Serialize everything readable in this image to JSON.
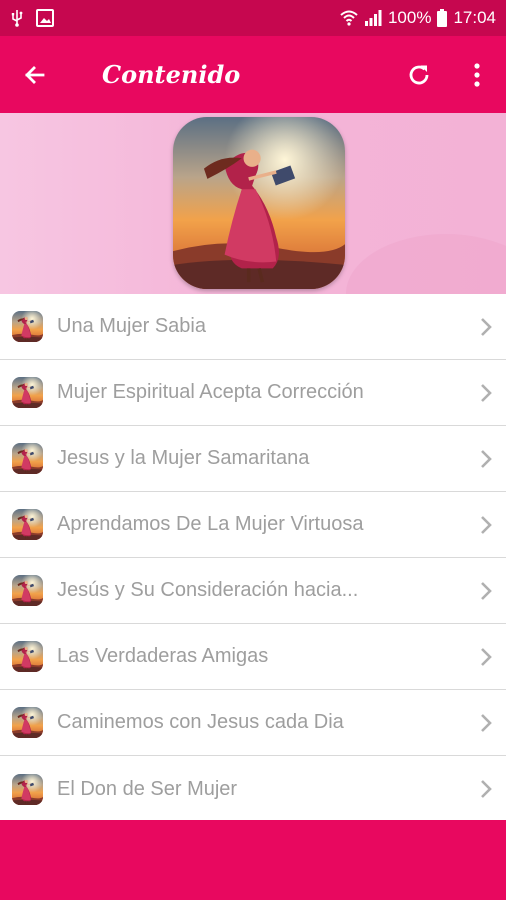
{
  "status_bar": {
    "battery": "100%",
    "time": "17:04",
    "icons": [
      "usb-icon",
      "image-icon",
      "wifi-icon",
      "signal-icon",
      "battery-icon"
    ]
  },
  "app_bar": {
    "title": "Contenido",
    "icons": [
      "arrow-back-icon",
      "refresh-icon",
      "more-vert-icon"
    ]
  },
  "list": {
    "items": [
      {
        "label": "Una Mujer Sabia"
      },
      {
        "label": "Mujer Espiritual Acepta Corrección"
      },
      {
        "label": "Jesus y la Mujer Samaritana"
      },
      {
        "label": "Aprendamos De La Mujer Virtuosa"
      },
      {
        "label": "Jesús y Su Consideración hacia..."
      },
      {
        "label": "Las Verdaderas Amigas"
      },
      {
        "label": "Caminemos con Jesus cada Dia"
      },
      {
        "label": "El Don de Ser Mujer"
      }
    ]
  },
  "colors": {
    "primary": "#e8085f",
    "status_bar": "#c6074f",
    "banner_bg": "#f4b5d8",
    "item_text": "#9e9e9e",
    "chevron": "#b0b0b0"
  }
}
